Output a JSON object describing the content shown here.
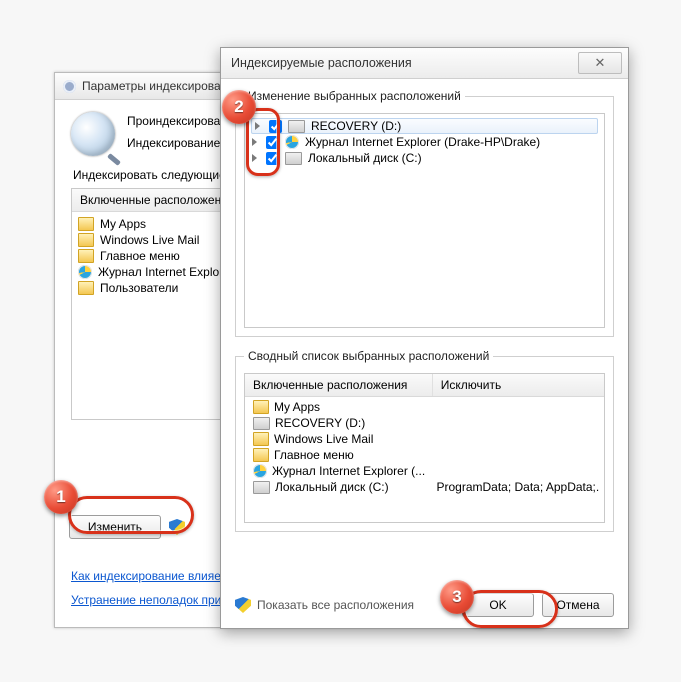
{
  "back": {
    "title": "Параметры индексирования",
    "status_line1": "Проиндексировано",
    "status_line2": "Индексирование",
    "section_label": "Индексировать следующие",
    "column_header": "Включенные расположения",
    "items": [
      {
        "icon": "folder",
        "label": "My Apps"
      },
      {
        "icon": "folder",
        "label": "Windows Live Mail"
      },
      {
        "icon": "folder",
        "label": "Главное меню"
      },
      {
        "icon": "ie",
        "label": "Журнал Internet Explorer"
      },
      {
        "icon": "folder",
        "label": "Пользователи"
      }
    ],
    "modify_btn": "Изменить",
    "link1": "Как индексирование влияет",
    "link2": "Устранение неполадок при"
  },
  "front": {
    "title": "Индексируемые расположения",
    "group1_legend": "Изменение выбранных расположений",
    "tree": [
      {
        "checked": true,
        "icon": "drive",
        "label": "RECOVERY (D:)",
        "selected": true
      },
      {
        "checked": true,
        "icon": "ie",
        "label": "Журнал Internet Explorer (Drake-HP\\Drake)"
      },
      {
        "checked": true,
        "icon": "drive",
        "label": "Локальный диск (C:)"
      }
    ],
    "group2_legend": "Сводный список выбранных расположений",
    "summary_headers": {
      "a": "Включенные расположения",
      "b": "Исключить"
    },
    "summary_rows": [
      {
        "icon": "folder",
        "a": "My Apps",
        "b": ""
      },
      {
        "icon": "drive",
        "a": "RECOVERY (D:)",
        "b": ""
      },
      {
        "icon": "folder",
        "a": "Windows Live Mail",
        "b": ""
      },
      {
        "icon": "folder",
        "a": "Главное меню",
        "b": ""
      },
      {
        "icon": "ie",
        "a": "Журнал Internet Explorer (...",
        "b": ""
      },
      {
        "icon": "drive",
        "a": "Локальный диск (C:)",
        "b": "ProgramData; Data; AppData;..."
      }
    ],
    "show_all": "Показать все расположения",
    "ok": "OK",
    "cancel": "Отмена"
  },
  "callouts": {
    "c1": "1",
    "c2": "2",
    "c3": "3"
  }
}
